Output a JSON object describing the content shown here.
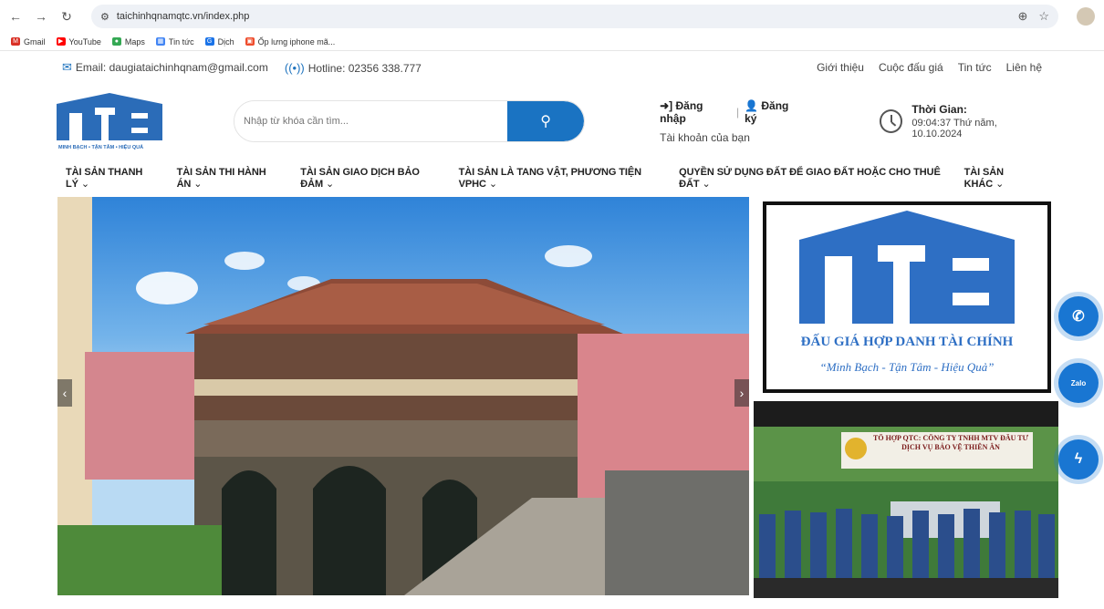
{
  "browser": {
    "url": "taichinhqnamqtc.vn/index.php",
    "bookmarks": [
      "Gmail",
      "YouTube",
      "Maps",
      "Tin tức",
      "Dịch",
      "Ốp lưng iphone mã..."
    ]
  },
  "topbar": {
    "email": "Email: daugiataichinhqnam@gmail.com",
    "hotline": "Hotline: 02356 338.777",
    "links": [
      "Giới thiệu",
      "Cuộc đấu giá",
      "Tin tức",
      "Liên hệ"
    ]
  },
  "header": {
    "logo_text": "QTC",
    "logo_tagline": "MINH BẠCH • TẬN TÂM • HIỆU QUẢ",
    "search_placeholder": "Nhập từ khóa cần tìm...",
    "login": "Đăng nhập",
    "register": "Đăng ký",
    "account_label": "Tài khoản của bạn",
    "time_title": "Thời Gian:",
    "time_value": "09:04:37 Thứ năm, 10.10.2024"
  },
  "menu": [
    "TÀI SẢN THANH LÝ",
    "TÀI SẢN THI HÀNH ÁN",
    "TÀI SẢN GIAO DỊCH BẢO ĐẢM",
    "TÀI SẢN LÀ TANG VẬT, PHƯƠNG TIỆN VPHC",
    "QUYỀN SỬ DỤNG ĐẤT ĐỂ GIAO ĐẤT HOẶC CHO THUÊ ĐẤT",
    "TÀI SẢN KHÁC"
  ],
  "ads": {
    "ad1_logo": "QTC",
    "ad1_title": "ĐẤU GIÁ HỢP DANH TÀI CHÍNH",
    "ad1_slogan": "“Minh Bạch - Tận Tâm - Hiệu Quả”",
    "ad2_title": "TỔ HỢP QTC: CÔNG TY TNHH MTV ĐẦU TƯ DỊCH VỤ BẢO VỆ THIÊN ÂN"
  },
  "floating": {
    "zalo": "Zalo"
  },
  "colors": {
    "brand_blue": "#1a73c2",
    "logo_blue": "#2b6cb8"
  }
}
